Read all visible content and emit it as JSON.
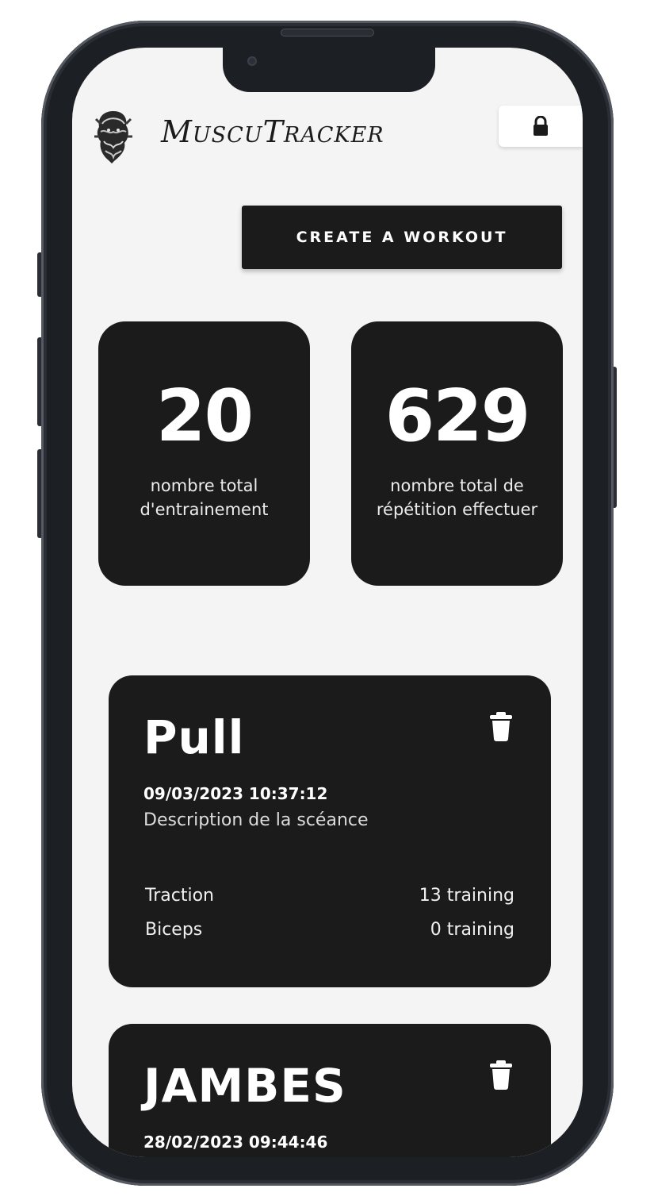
{
  "app": {
    "brand": "MuscuTracker",
    "logo_icon": "bearded-warrior-logo-icon",
    "lock_icon": "lock-icon"
  },
  "actions": {
    "create_workout_label": "CREATE A WORKOUT"
  },
  "stats": [
    {
      "value": "20",
      "label": "nombre total d'entrainement"
    },
    {
      "value": "629",
      "label": "nombre total de répétition effectuer"
    }
  ],
  "workouts": [
    {
      "title": "Pull",
      "datetime": "09/03/2023 10:37:12",
      "description": "Description de la scéance",
      "exercises": [
        {
          "name": "Traction",
          "count": "13 training"
        },
        {
          "name": "Biceps",
          "count": "0 training"
        }
      ],
      "delete_icon": "trash-icon"
    },
    {
      "title": "JAMBES",
      "datetime": "28/02/2023 09:44:46",
      "delete_icon": "trash-icon"
    }
  ],
  "colors": {
    "card": "#1b1b1b",
    "background": "#f4f4f4",
    "frame": "#1c1f24"
  }
}
